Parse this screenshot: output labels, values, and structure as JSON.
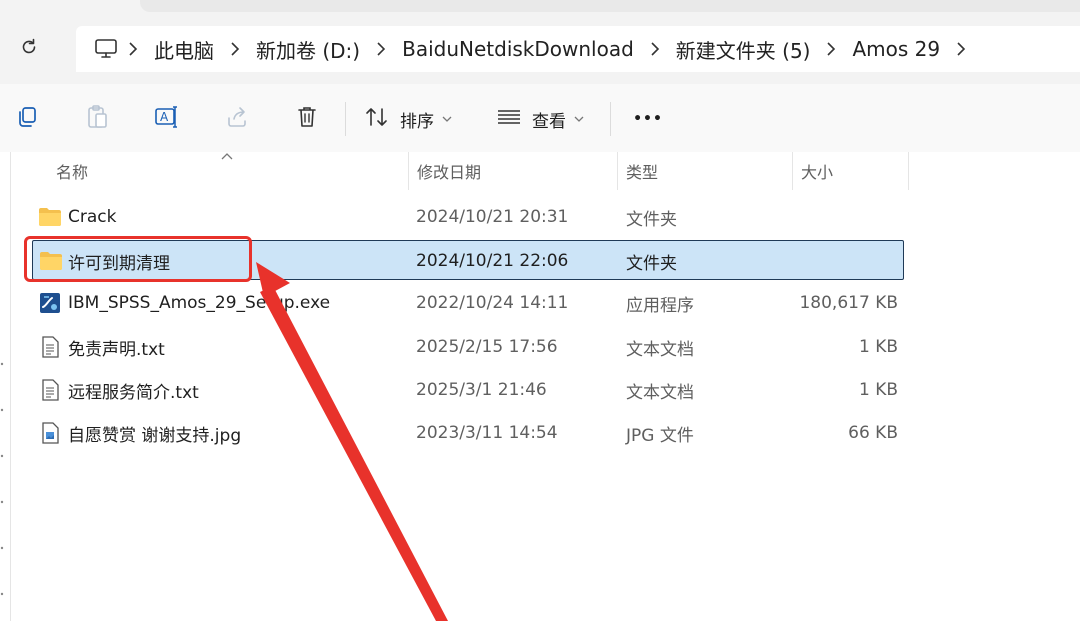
{
  "breadcrumb": {
    "items": [
      "此电脑",
      "新加卷 (D:)",
      "BaiduNetdiskDownload",
      "新建文件夹 (5)",
      "Amos 29"
    ]
  },
  "toolbar": {
    "sort_label": "排序",
    "view_label": "查看",
    "more_label": "•••"
  },
  "columns": {
    "name": "名称",
    "modified": "修改日期",
    "type": "类型",
    "size": "大小"
  },
  "files": [
    {
      "name": "Crack",
      "modified": "2024/10/21 20:31",
      "type": "文件夹",
      "size": "",
      "icon": "folder-icon"
    },
    {
      "name": "许可到期清理",
      "modified": "2024/10/21 22:06",
      "type": "文件夹",
      "size": "",
      "icon": "folder-icon",
      "selected": true
    },
    {
      "name": "IBM_SPSS_Amos_29_Setup.exe",
      "modified": "2022/10/24 14:11",
      "type": "应用程序",
      "size": "180,617 KB",
      "icon": "setup-exe-icon"
    },
    {
      "name": "免责声明.txt",
      "modified": "2025/2/15 17:56",
      "type": "文本文档",
      "size": "1 KB",
      "icon": "text-file-icon"
    },
    {
      "name": "远程服务简介.txt",
      "modified": "2025/3/1 21:46",
      "type": "文本文档",
      "size": "1 KB",
      "icon": "text-file-icon"
    },
    {
      "name": "自愿赞赏 谢谢支持.jpg",
      "modified": "2023/3/11 14:54",
      "type": "JPG 文件",
      "size": "66 KB",
      "icon": "image-file-icon"
    }
  ],
  "colors": {
    "selection_fill": "#cce4f7",
    "selection_border": "#1f3a57",
    "annotation_red": "#e8322b",
    "folder_yellow": "#f4c04e"
  }
}
